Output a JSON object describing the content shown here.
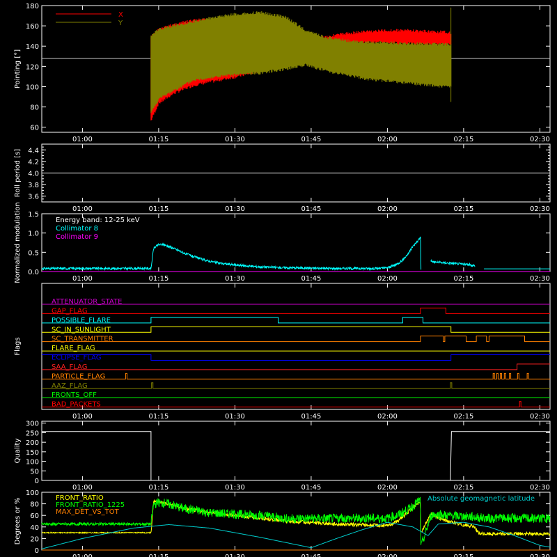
{
  "chart_data": [
    {
      "type": "line",
      "ylabel": "Pointing [°]",
      "yticks": [
        60,
        80,
        100,
        120,
        140,
        160,
        180
      ],
      "ylim": [
        55,
        180
      ],
      "xticks": [
        "01:00",
        "01:15",
        "01:30",
        "01:45",
        "02:00",
        "02:15",
        "02:30"
      ],
      "xlim_minutes": [
        52,
        152
      ],
      "reference_line": 128,
      "legend_placement": "top-left",
      "series": [
        {
          "name": "X",
          "color": "#ff0000",
          "t": [
            73.5,
            75,
            78,
            82,
            86,
            90,
            95,
            100,
            104,
            108,
            112,
            116,
            120,
            124,
            128,
            132.5
          ],
          "upper": [
            150,
            158,
            163,
            167,
            168,
            166,
            160,
            152,
            148,
            151,
            154,
            156,
            157,
            157,
            156,
            155
          ],
          "lower": [
            65,
            82,
            92,
            100,
            104,
            108,
            114,
            120,
            128,
            137,
            141,
            142,
            142,
            141,
            140,
            140
          ]
        },
        {
          "name": "Y",
          "color": "#808000",
          "t": [
            73.5,
            75,
            78,
            82,
            86,
            90,
            95,
            100,
            104,
            108,
            112,
            116,
            120,
            124,
            128,
            132.5
          ],
          "upper": [
            152,
            158,
            162,
            166,
            170,
            173,
            175,
            170,
            157,
            150,
            147,
            145,
            145,
            144,
            144,
            143
          ],
          "lower": [
            73,
            86,
            95,
            105,
            108,
            110,
            112,
            116,
            120,
            114,
            110,
            106,
            104,
            102,
            100,
            98
          ]
        }
      ]
    },
    {
      "type": "line",
      "ylabel": "Roll period [s]",
      "yticks": [
        "3.6",
        "3.8",
        "4.0",
        "4.2",
        "4.4"
      ],
      "ytick_values": [
        3.6,
        3.8,
        4.0,
        4.2,
        4.4
      ],
      "ylim": [
        3.5,
        4.5
      ],
      "xticks": [
        "01:00",
        "01:15",
        "01:30",
        "01:45",
        "02:00",
        "02:15",
        "02:30"
      ],
      "series": [
        {
          "name": "",
          "color": "#ffffff",
          "t": [
            52,
            152
          ],
          "values": [
            4.0,
            4.0
          ]
        }
      ]
    },
    {
      "type": "line",
      "ylabel": "Normalized modulation",
      "annotation": "Energy band: 12-25 keV",
      "yticks": [
        "0.0",
        "0.5",
        "1.0",
        "1.5"
      ],
      "ytick_values": [
        0,
        0.5,
        1.0,
        1.5
      ],
      "ylim": [
        0,
        1.5
      ],
      "xticks": [
        "01:00",
        "01:15",
        "01:30",
        "01:45",
        "02:00",
        "02:15",
        "02:30"
      ],
      "series": [
        {
          "name": "Collimator 8",
          "color": "#00ffff",
          "segments": [
            {
              "t": [
                52,
                60,
                70,
                73.5
              ],
              "values": [
                0.08,
                0.08,
                0.08,
                0.08
              ]
            },
            {
              "t": [
                73.5,
                74,
                75,
                76,
                78,
                80,
                82,
                84,
                86,
                88,
                90,
                95,
                100,
                105,
                110,
                115,
                118,
                120,
                121,
                122,
                123,
                124,
                125,
                126,
                126.5
              ],
              "values": [
                0.08,
                0.6,
                0.7,
                0.7,
                0.6,
                0.48,
                0.38,
                0.3,
                0.24,
                0.2,
                0.17,
                0.12,
                0.1,
                0.09,
                0.08,
                0.08,
                0.08,
                0.1,
                0.14,
                0.2,
                0.3,
                0.45,
                0.65,
                0.8,
                0.9
              ]
            },
            {
              "t": [
                126.5,
                126.5,
                126.6
              ],
              "values": [
                0.9,
                1.45,
                0.05
              ]
            },
            {
              "t": [
                128.5,
                129,
                130,
                132,
                134,
                136,
                137.2
              ],
              "values": [
                0.3,
                0.25,
                0.24,
                0.22,
                0.2,
                0.18,
                0.15
              ]
            },
            {
              "t": [
                139,
                145,
                152
              ],
              "values": [
                0.07,
                0.07,
                0.07
              ]
            }
          ]
        },
        {
          "name": "Collimator 9",
          "color": "#ff00ff",
          "segments": [
            {
              "t": [
                52,
                152
              ],
              "values": [
                0,
                0
              ]
            }
          ]
        }
      ]
    },
    {
      "type": "line",
      "ylabel": "Flags",
      "xticks": [
        "01:00",
        "01:15",
        "01:30",
        "01:45",
        "02:00",
        "02:15",
        "02:30"
      ],
      "series": [
        {
          "name": "ATTENUATOR_STATE",
          "color": "#cc00cc",
          "steps": [
            [
              52,
              0
            ],
            [
              152,
              0
            ]
          ]
        },
        {
          "name": "GAP_FLAG",
          "color": "#ff0000",
          "steps": [
            [
              52,
              0
            ],
            [
              126.5,
              1
            ],
            [
              131.5,
              0
            ],
            [
              152,
              0
            ]
          ]
        },
        {
          "name": "POSSIBLE_FLARE",
          "color": "#00ffff",
          "steps": [
            [
              52,
              0
            ],
            [
              73.5,
              1
            ],
            [
              98.5,
              0
            ],
            [
              123,
              1
            ],
            [
              127,
              0
            ],
            [
              152,
              0
            ]
          ]
        },
        {
          "name": "SC_IN_SUNLIGHT",
          "color": "#ffff00",
          "steps": [
            [
              52,
              0
            ],
            [
              73.5,
              1
            ],
            [
              132.5,
              0
            ],
            [
              152,
              0
            ]
          ]
        },
        {
          "name": "SC_TRANSMITTER",
          "color": "#ff8000",
          "steps": [
            [
              52,
              0
            ],
            [
              126.5,
              1
            ],
            [
              131,
              0
            ],
            [
              131.3,
              1
            ],
            [
              135.5,
              0
            ],
            [
              137.5,
              1
            ],
            [
              139.5,
              0
            ],
            [
              140,
              1
            ],
            [
              147,
              0
            ],
            [
              152,
              0
            ]
          ]
        },
        {
          "name": "FLARE_FLAG",
          "color": "#ffff00",
          "steps": [
            [
              52,
              0
            ],
            [
              152,
              0
            ]
          ]
        },
        {
          "name": "ECLIPSE_FLAG",
          "color": "#0000ff",
          "steps": [
            [
              52,
              1
            ],
            [
              73.5,
              0
            ],
            [
              132.5,
              1
            ],
            [
              152,
              1
            ]
          ]
        },
        {
          "name": "SAA_FLAG",
          "color": "#ff2020",
          "steps": [
            [
              52,
              0
            ],
            [
              145.5,
              1
            ],
            [
              152,
              1
            ]
          ]
        },
        {
          "name": "PARTICLE_FLAG",
          "color": "#ff8000",
          "pulses": [
            68.5,
            140.8,
            141.5,
            142.2,
            143,
            144,
            145.6,
            147.5
          ]
        },
        {
          "name": "AAZ_FLAG",
          "color": "#808000",
          "pulses": [
            73.6,
            132.4
          ]
        },
        {
          "name": "FRONTS_OFF",
          "color": "#00ff00",
          "steps": [
            [
              52,
              0
            ],
            [
              152,
              0
            ]
          ]
        },
        {
          "name": "BAD_PACKETS",
          "color": "#ff0000",
          "pulses": [
            146
          ]
        }
      ]
    },
    {
      "type": "line",
      "ylabel": "Quality",
      "yticks": [
        "0",
        "50",
        "100",
        "150",
        "200",
        "250",
        "300"
      ],
      "ytick_values": [
        0,
        50,
        100,
        150,
        200,
        250,
        300
      ],
      "ylim": [
        0,
        310
      ],
      "xticks": [
        "01:00",
        "01:15",
        "01:30",
        "01:45",
        "02:00",
        "02:15",
        "02:30"
      ],
      "series": [
        {
          "name": "",
          "color": "#ffffff",
          "t": [
            52,
            73.5,
            73.5,
            132.4,
            132.4,
            132.6,
            152
          ],
          "values": [
            256,
            256,
            0,
            0,
            10,
            256,
            256
          ]
        }
      ]
    },
    {
      "type": "line",
      "ylabel": "Degrees or %",
      "yticks": [
        "0",
        "20",
        "40",
        "60",
        "80",
        "100"
      ],
      "ytick_values": [
        0,
        20,
        40,
        60,
        80,
        100
      ],
      "ylim": [
        0,
        100
      ],
      "xticks": [
        "01:00",
        "01:15",
        "01:30",
        "01:45",
        "02:00",
        "02:15",
        "02:30"
      ],
      "legend_placement": "top-left",
      "series": [
        {
          "name": "FRONT_RATIO",
          "color": "#ffff00",
          "t": [
            52,
            60,
            70,
            73.5,
            74,
            76,
            80,
            85,
            90,
            95,
            100,
            110,
            120,
            122,
            124,
            126.5,
            126.6,
            128.5,
            129,
            130,
            132,
            134,
            136,
            137.2,
            138,
            145,
            152
          ],
          "values": [
            30,
            30,
            30,
            30,
            85,
            82,
            72,
            65,
            60,
            55,
            50,
            45,
            42,
            50,
            65,
            85,
            30,
            62,
            62,
            55,
            50,
            45,
            42,
            40,
            28,
            28,
            28
          ]
        },
        {
          "name": "FRONT_RATIO_1225",
          "color": "#00ff00",
          "t": [
            52,
            60,
            70,
            73.5,
            74,
            76,
            80,
            85,
            90,
            95,
            100,
            110,
            120,
            122,
            124,
            126.5,
            126.6,
            128.5,
            129,
            132,
            136,
            140,
            145,
            152
          ],
          "values": [
            45,
            45,
            45,
            45,
            80,
            82,
            72,
            65,
            62,
            60,
            55,
            55,
            55,
            60,
            70,
            87,
            5,
            58,
            62,
            60,
            58,
            55,
            55,
            55
          ]
        },
        {
          "name": "MAX_DET_VS_TOT",
          "color": "#ff8000",
          "t": [
            52,
            152
          ],
          "values": [
            0,
            0
          ]
        },
        {
          "name": "Absolute geomagnetic latitude",
          "color": "#00cccc",
          "t": [
            52,
            60,
            70,
            77,
            85,
            95,
            105,
            110,
            115,
            120,
            125,
            128,
            130,
            135,
            140,
            145,
            150,
            152
          ],
          "values": [
            2,
            20,
            38,
            44,
            38,
            22,
            4,
            20,
            35,
            48,
            40,
            25,
            45,
            48,
            40,
            25,
            8,
            5
          ]
        }
      ]
    }
  ]
}
